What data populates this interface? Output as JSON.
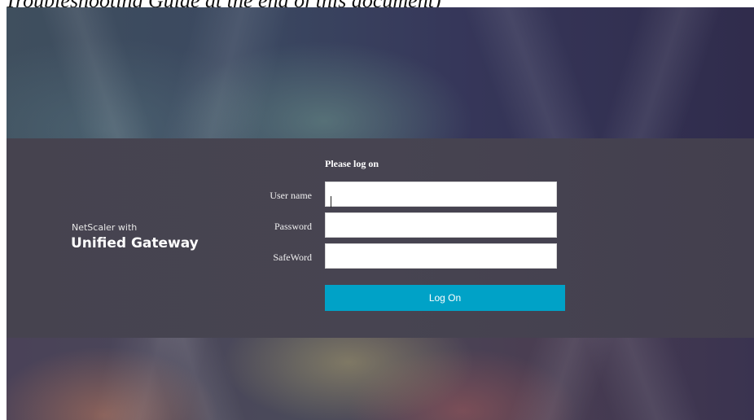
{
  "document": {
    "caption": "Troubleshooting Guide at the end of this document)"
  },
  "branding": {
    "line1": "NetScaler with",
    "line2": "Unified Gateway"
  },
  "login_form": {
    "title": "Please log on",
    "fields": [
      {
        "label": "User name",
        "value": ""
      },
      {
        "label": "Password",
        "value": ""
      },
      {
        "label": "SafeWord",
        "value": ""
      }
    ],
    "submit_label": "Log On"
  },
  "colors": {
    "accent": "#00a2c7",
    "band": "#46434f"
  }
}
